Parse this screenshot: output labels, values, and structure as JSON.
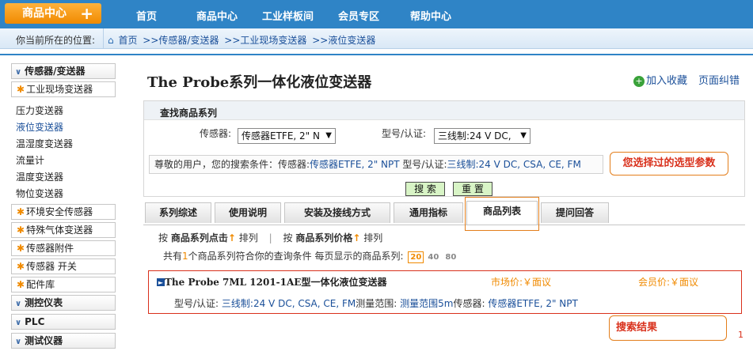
{
  "top": {
    "category_button": "商品中心",
    "nav": [
      "首页",
      "商品中心",
      "工业样板间",
      "会员专区",
      "帮助中心"
    ]
  },
  "breadcrumb": {
    "label": "你当前所在的位置:",
    "items": [
      "首页",
      ">>传感器/变送器",
      ">>工业现场变送器",
      ">>液位变送器"
    ]
  },
  "sidebar": {
    "head1": "传感器/变送器",
    "sub1": "工业现场变送器",
    "plain": [
      "压力变送器",
      "液位变送器",
      "温湿度变送器",
      "流量计",
      "温度变送器",
      "物位变送器"
    ],
    "subs": [
      "环境安全传感器",
      "特殊气体变送器",
      "传感器附件",
      "传感器 开关",
      "配件库"
    ],
    "head2": "测控仪表",
    "head3": "PLC",
    "head4": "测试仪器"
  },
  "main": {
    "title": "The Probe系列一体化液位变送器",
    "fav": "加入收藏",
    "correct": "页面纠错"
  },
  "search": {
    "title": "查找商品系列",
    "sensor_label": "传感器:",
    "sensor_value": "传感器ETFE, 2\" N",
    "model_label": "型号/认证:",
    "model_value": "三线制:24 V DC,",
    "cond_prefix": "尊敬的用户，您的搜索条件：传感器:",
    "cond_sensor": "传感器ETFE, 2\" NPT",
    "cond_model_label": " 型号/认证:",
    "cond_model": "三线制:24 V DC, CSA, CE, FM",
    "callout": "您选择过的选型参数",
    "search_btn": "搜 索",
    "reset_btn": "重 置"
  },
  "tabs": [
    "系列综述",
    "使用说明",
    "安装及接线方式",
    "通用指标",
    "商品列表",
    "提问回答"
  ],
  "results": {
    "sort_by": "按",
    "sort_click": "商品系列点击",
    "sort_label": "排列",
    "sort_by2": "按",
    "sort_price": "商品系列价格",
    "sort_label2": "排列",
    "count_prefix": "共有",
    "count": "1",
    "count_suffix": "个商品系列符合你的查询条件   每页显示的商品系列:",
    "page_sizes": [
      "20",
      "40",
      "80"
    ],
    "item_title": "The Probe 7ML 1201-1AE型一体化液位变送器",
    "market_price": "市场价:￥面议",
    "member_price": "会员价:￥面议",
    "spec_model_label": "型号/认证:",
    "spec_model": "三线制:24 V DC, CSA, CE, FM",
    "spec_range_label": "测量范围:",
    "spec_range": "测量范围5m",
    "spec_sensor_label": "传感器:",
    "spec_sensor": "传感器ETFE, 2\" NPT",
    "callout": "搜索结果",
    "page": "1"
  }
}
